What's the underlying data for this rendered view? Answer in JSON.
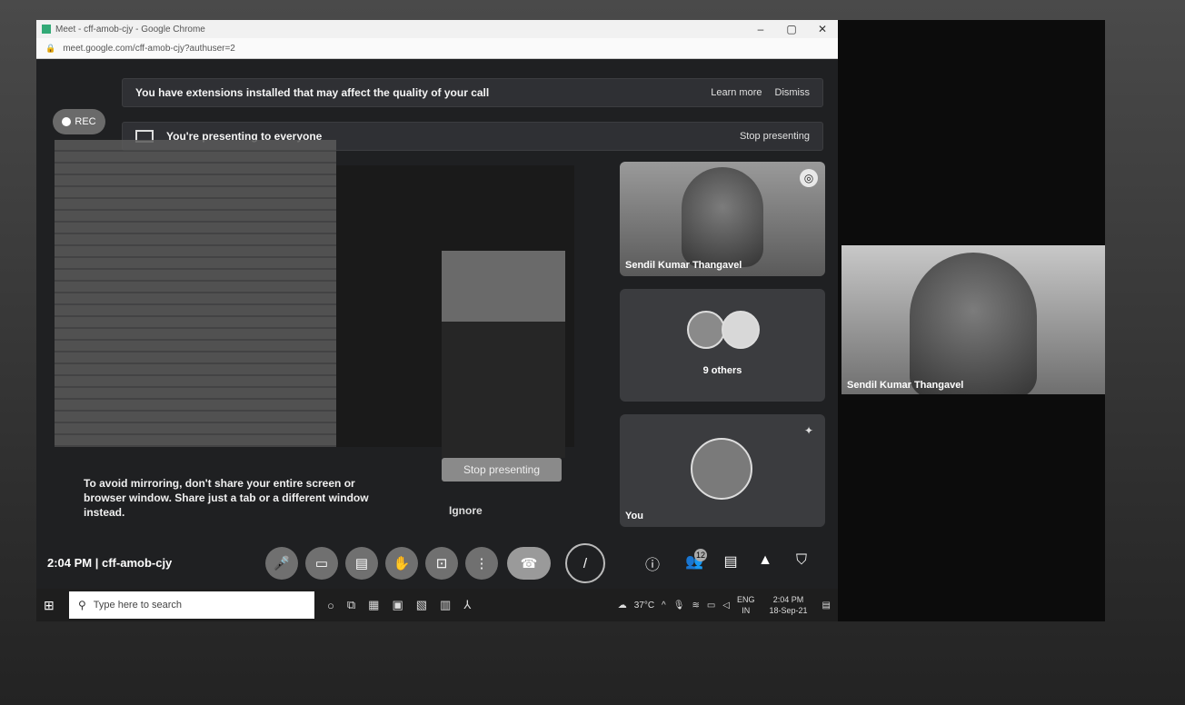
{
  "browser": {
    "title": "Meet - cff-amob-cjy - Google Chrome",
    "url": "meet.google.com/cff-amob-cjy?authuser=2",
    "minimize": "–",
    "maximize": "▢",
    "close": "✕"
  },
  "banners": {
    "extensions_text": "You have extensions installed that may affect the quality of your call",
    "learn_more": "Learn more",
    "dismiss": "Dismiss",
    "presenting_text": "You're presenting to everyone",
    "stop_presenting": "Stop presenting"
  },
  "rec_label": "REC",
  "presentation": {
    "stop_presenting_button": "Stop presenting",
    "ignore": "Ignore",
    "mirror_warning": "To avoid mirroring, don't share your entire screen or browser window. Share just a tab or a different window instead."
  },
  "participants": {
    "main_name": "Sendil Kumar Thangavel",
    "others_label": "9 others",
    "you_label": "You"
  },
  "controls": {
    "meeting_info": "2:04 PM  |  cff-amob-cjy",
    "participant_count": "12"
  },
  "taskbar": {
    "search_placeholder": "Type here to search",
    "weather": "37°C",
    "lang_top": "ENG",
    "lang_bottom": "IN",
    "time": "2:04 PM",
    "date": "18-Sep-21"
  },
  "selfview": {
    "name": "Sendil Kumar Thangavel"
  }
}
